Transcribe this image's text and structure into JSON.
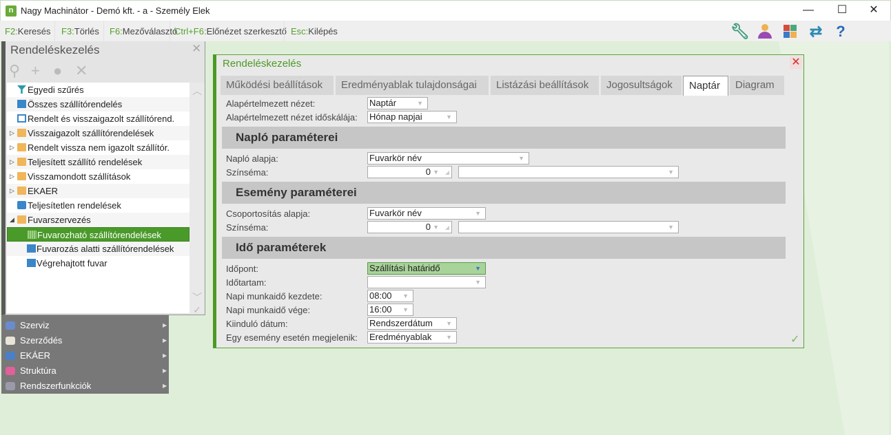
{
  "window": {
    "title": "Nagy Machinátor - Demó kft. - a - Személy Elek",
    "logo": "n",
    "min": "—",
    "max": "☐",
    "close": "✕"
  },
  "shortcuts": [
    {
      "key": "F2:",
      "label": "Keresés"
    },
    {
      "key": "F3:",
      "label": "Törlés"
    },
    {
      "key": "F6:",
      "label": "Mezőválasztó"
    },
    {
      "key": "Ctrl+F6:",
      "label": "Előnézet szerkesztő"
    },
    {
      "key": "Esc:",
      "label": "Kilépés"
    }
  ],
  "toolbar_icons": [
    "wrench-icon",
    "user-icon",
    "tiles-icon",
    "swap-icon",
    "help-icon"
  ],
  "left_panel": {
    "title": "Rendeléskezelés",
    "close": "✕",
    "tree": [
      {
        "label": "Egyedi szűrés",
        "icon": "filter-icon"
      },
      {
        "label": "Összes szállítórendelés",
        "icon": "monitor-icon"
      },
      {
        "label": "Rendelt és visszaigazolt szállítórend.",
        "icon": "report-icon"
      },
      {
        "label": "Visszaigazolt szállítórendelések",
        "icon": "folder-icon"
      },
      {
        "label": "Rendelt vissza nem igazolt szállítór.",
        "icon": "folder-icon"
      },
      {
        "label": "Teljesített szállító rendelések",
        "icon": "folder-icon"
      },
      {
        "label": "Visszamondott szállítások",
        "icon": "folder-icon"
      },
      {
        "label": "EKAER",
        "icon": "folder-icon"
      },
      {
        "label": "Teljesítetlen rendelések",
        "icon": "printer-icon"
      },
      {
        "label": "Fuvarszervezés",
        "icon": "folder-open-icon"
      },
      {
        "label": "Fuvarozható szállítórendelések",
        "icon": "grid-icon"
      },
      {
        "label": "Fuvarozás alatti szállítórendelések",
        "icon": "monitor-icon"
      },
      {
        "label": "Végrehajtott fuvar",
        "icon": "monitor-icon"
      }
    ]
  },
  "menu": [
    {
      "label": "Szerviz",
      "color": "#6a8ccc"
    },
    {
      "label": "Szerződés",
      "color": "#e8e4d8"
    },
    {
      "label": "EKÁER",
      "color": "#4a80c8"
    },
    {
      "label": "Struktúra",
      "color": "#e0609a"
    },
    {
      "label": "Rendszerfunkciók",
      "color": "#9a9aaa"
    }
  ],
  "dialog": {
    "title": "Rendeléskezelés",
    "close": "✕",
    "ok": "✓",
    "tabs": [
      "Működési beállítások",
      "Eredményablak tulajdonságai",
      "Listázási beállítások",
      "Jogosultságok",
      "Naptár",
      "Diagram"
    ],
    "active_tab": "Naptár",
    "general": [
      {
        "label": "Alapértelmezett nézet:",
        "value": "Naptár"
      },
      {
        "label": "Alapértelmezett nézet időskálája:",
        "value": "Hónap napjai"
      }
    ],
    "naplo": {
      "title": "Napló paraméterei",
      "alapja_label": "Napló alapja:",
      "alapja": "Fuvarkör név",
      "szinsema_label": "Színséma:",
      "szinsema": "0",
      "szinsema_color": ""
    },
    "esemeny": {
      "title": "Esemény paraméterei",
      "alapja_label": "Csoportosítás alapja:",
      "alapja": "Fuvarkör név",
      "szinsema_label": "Színséma:",
      "szinsema": "0",
      "szinsema_color": ""
    },
    "ido": {
      "title": "Idő paraméterek",
      "rows": [
        {
          "label": "Időpont:",
          "value": "Szállítási határidő"
        },
        {
          "label": "Időtartam:",
          "value": ""
        },
        {
          "label": "Napi munkaidő kezdete:",
          "value": "08:00"
        },
        {
          "label": "Napi munkaidő vége:",
          "value": "16:00"
        },
        {
          "label": "Kiinduló dátum:",
          "value": "Rendszerdátum"
        },
        {
          "label": "Egy esemény esetén megjelenik:",
          "value": "Eredményablak"
        }
      ]
    }
  }
}
